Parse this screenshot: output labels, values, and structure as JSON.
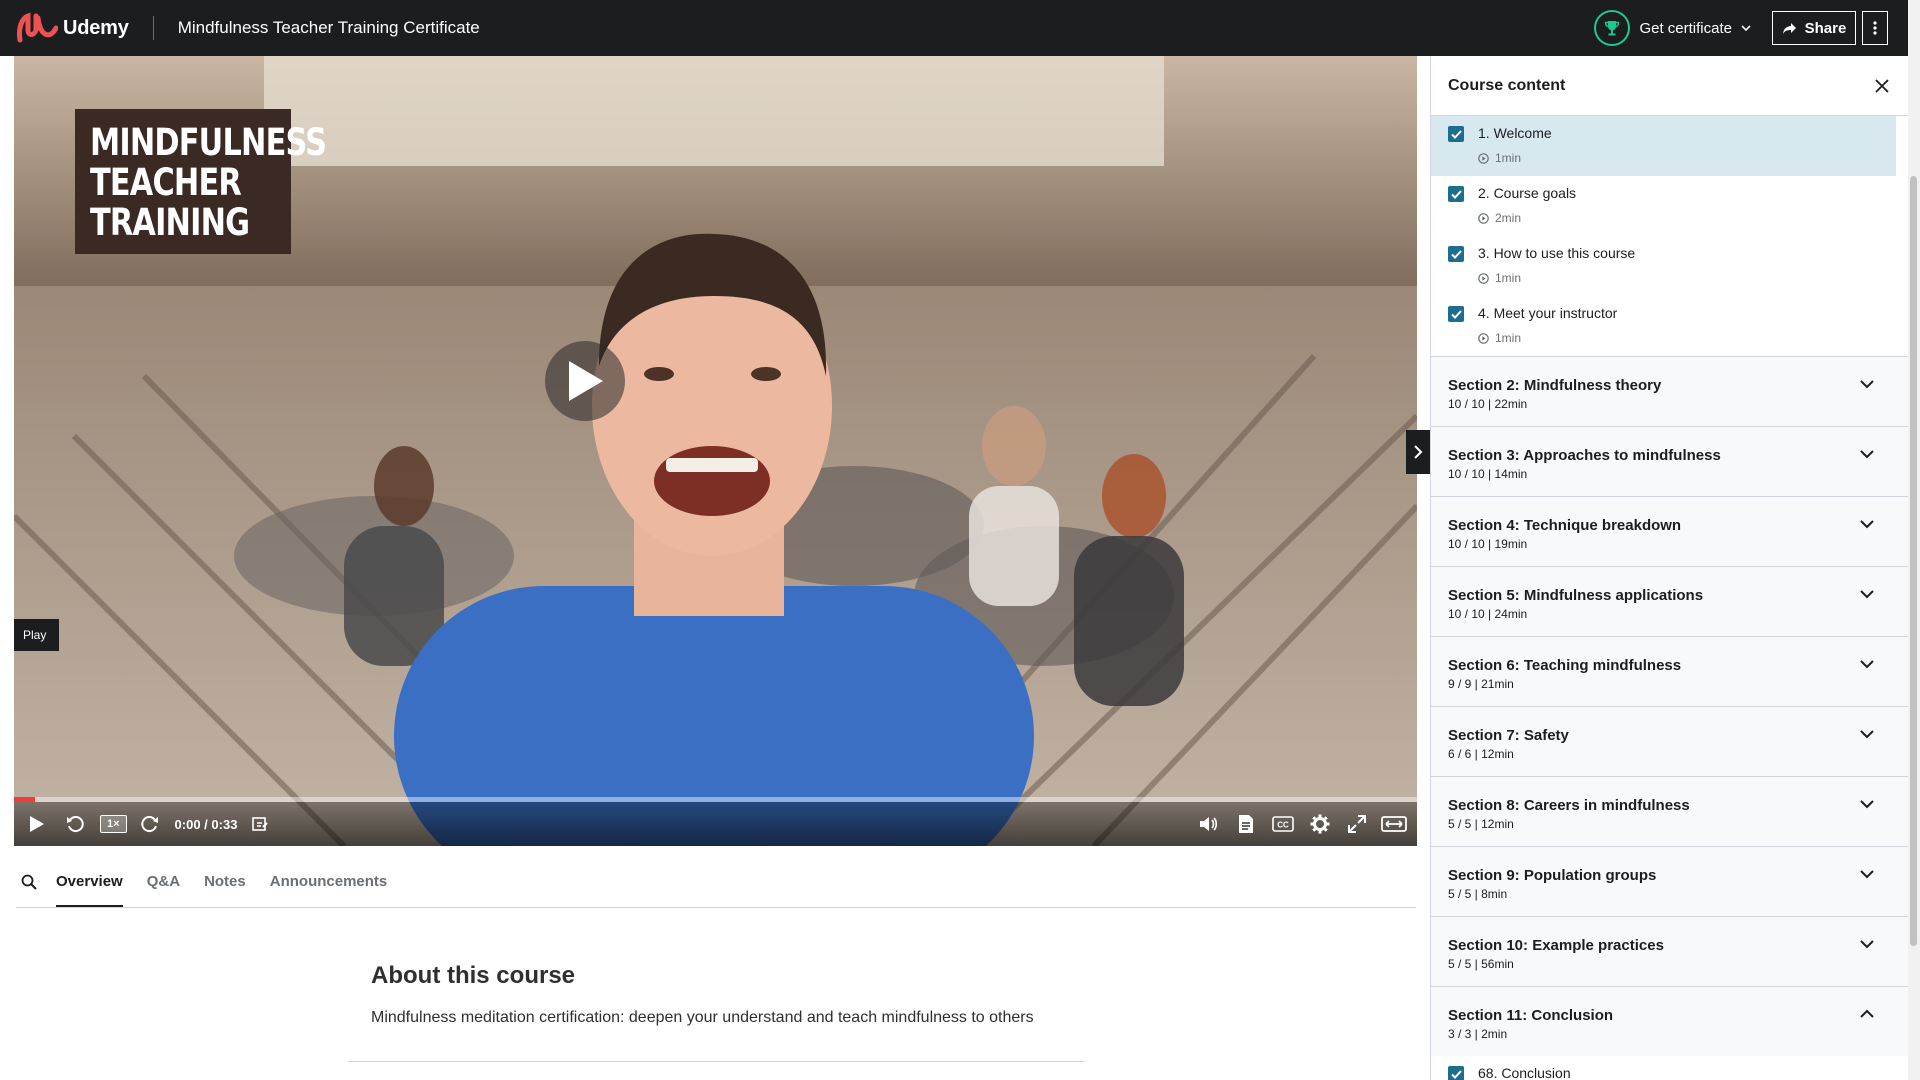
{
  "header": {
    "brand": "Udemy",
    "course_title": "Mindfulness Teacher Training Certificate",
    "certificate_label": "Get certificate",
    "share_label": "Share",
    "accent_color": "#a435f0",
    "logo_color": "#ec5252",
    "trophy_color": "#1ec98e"
  },
  "video": {
    "title_card": [
      "MINDFULNESS",
      "TEACHER",
      "TRAINING"
    ],
    "tooltip": "Play",
    "speed": "1×",
    "time": "0:00 / 0:33",
    "progress_fraction": 0.015,
    "controls_left": [
      "play-icon",
      "rewind-icon",
      "forward-icon",
      "note-icon"
    ],
    "controls_right": [
      "volume-icon",
      "transcript-icon",
      "captions-icon",
      "settings-icon",
      "fullscreen-icon",
      "expand-icon"
    ],
    "captions_label": "CC"
  },
  "tabs": {
    "items": [
      "Overview",
      "Q&A",
      "Notes",
      "Announcements"
    ],
    "active": "Overview"
  },
  "about": {
    "title": "About this course",
    "description": "Mindfulness meditation certification: deepen your understand and teach mindfulness to others"
  },
  "sidebar": {
    "title": "Course content",
    "lectures": [
      {
        "title": "1. Welcome",
        "duration": "1min",
        "checked": true,
        "current": true
      },
      {
        "title": "2. Course goals",
        "duration": "2min",
        "checked": true,
        "current": false
      },
      {
        "title": "3. How to use this course",
        "duration": "1min",
        "checked": true,
        "current": false
      },
      {
        "title": "4. Meet your instructor",
        "duration": "1min",
        "checked": true,
        "current": false
      }
    ],
    "sections": [
      {
        "title": "Section 2: Mindfulness theory",
        "meta": "10 / 10 | 22min",
        "expanded": false
      },
      {
        "title": "Section 3: Approaches to mindfulness",
        "meta": "10 / 10 | 14min",
        "expanded": false
      },
      {
        "title": "Section 4: Technique breakdown",
        "meta": "10 / 10 | 19min",
        "expanded": false
      },
      {
        "title": "Section 5: Mindfulness applications",
        "meta": "10 / 10 | 24min",
        "expanded": false
      },
      {
        "title": "Section 6: Teaching mindfulness",
        "meta": "9 / 9 | 21min",
        "expanded": false
      },
      {
        "title": "Section 7: Safety",
        "meta": "6 / 6 | 12min",
        "expanded": false
      },
      {
        "title": "Section 8: Careers in mindfulness",
        "meta": "5 / 5 | 12min",
        "expanded": false
      },
      {
        "title": "Section 9: Population groups",
        "meta": "5 / 5 | 8min",
        "expanded": false
      },
      {
        "title": "Section 10: Example practices",
        "meta": "5 / 5 | 56min",
        "expanded": false
      },
      {
        "title": "Section 11: Conclusion",
        "meta": "3 / 3 | 2min",
        "expanded": true
      }
    ],
    "trailing_lecture": {
      "title": "68. Conclusion",
      "checked": true
    }
  }
}
